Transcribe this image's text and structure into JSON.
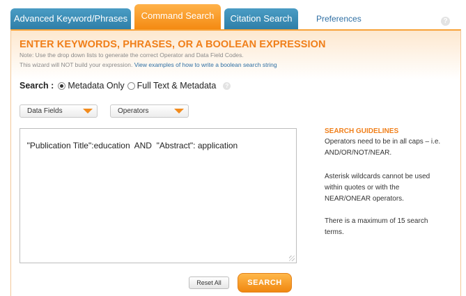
{
  "tabs": {
    "advanced": "Advanced Keyword/Phrases",
    "command": "Command Search",
    "citation": "Citation Search",
    "preferences": "Preferences"
  },
  "heading": "ENTER KEYWORDS, PHRASES, OR A BOOLEAN EXPRESSION",
  "note_line1": "Note: Use the drop down lists to generate the correct Operator and Data Field Codes.",
  "note_line2": "This wizard will NOT build your expression.",
  "note_link": "View examples of how to write a boolean search string",
  "search_scope": {
    "label": "Search :",
    "option1": "Metadata Only",
    "option2": "Full Text & Metadata",
    "selected": "Metadata Only"
  },
  "dropdowns": {
    "data_fields": "Data Fields",
    "operators": "Operators"
  },
  "query_value": "\"Publication Title\":education  AND  \"Abstract\": application",
  "guidelines": {
    "title": "SEARCH GUIDELINES",
    "rule1": "Operators need to be in all caps – i.e. AND/OR/NOT/NEAR.",
    "rule2": "Asterisk wildcards cannot be used within quotes or with the NEAR/ONEAR operators.",
    "rule3": "There is a maximum of 15 search terms."
  },
  "buttons": {
    "reset": "Reset All",
    "search": "SEARCH"
  },
  "colors": {
    "accent_orange": "#f07f1a",
    "tab_blue": "#2f7fa8",
    "link_blue": "#2e6fa3"
  }
}
